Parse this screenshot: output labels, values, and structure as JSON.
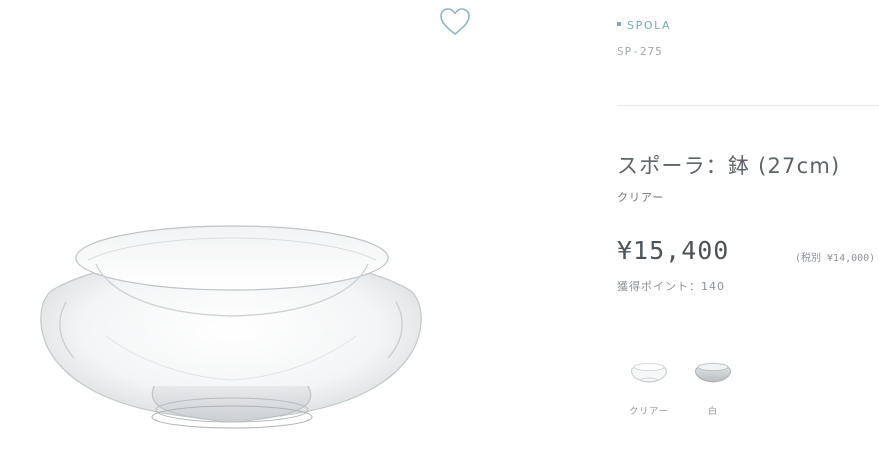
{
  "product": {
    "brand": "SPOLA",
    "sku": "SP-275",
    "title": "スポーラ：鉢 (27cm)",
    "color": "クリアー",
    "price": "¥15,400",
    "tax_note": "(税別 ¥14,000)",
    "points": "獲得ポイント：140"
  },
  "variants": [
    {
      "label": "クリアー"
    },
    {
      "label": "白"
    }
  ],
  "icons": {
    "favorite": "heart-outline-icon"
  },
  "colors": {
    "accent": "#7aa7b1",
    "text": "#5e6368",
    "muted": "#8e9297",
    "divider": "#e6e8ea"
  }
}
